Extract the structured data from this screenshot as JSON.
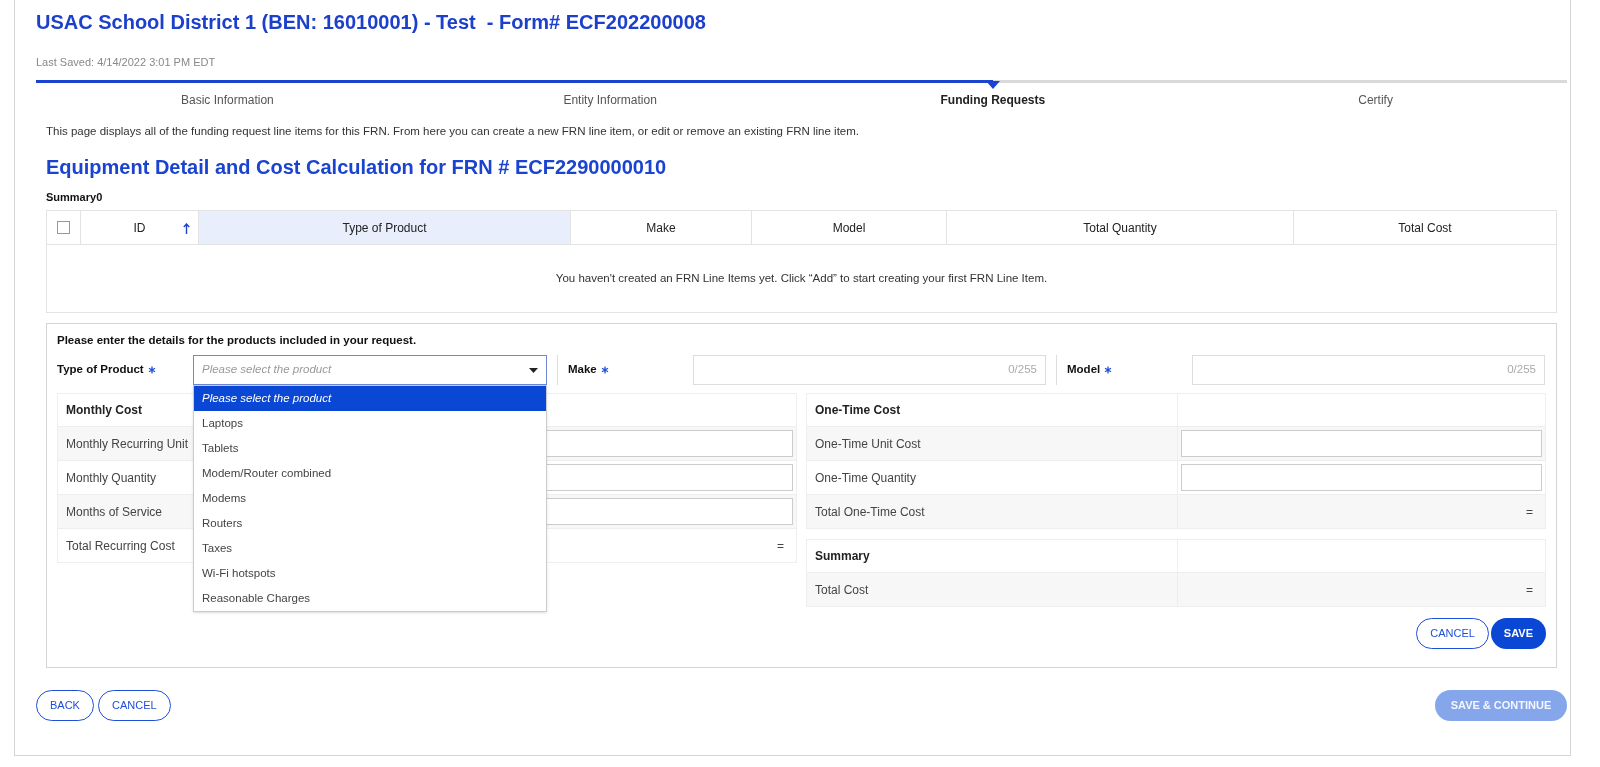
{
  "header": {
    "title": "USAC School District 1 (BEN: 16010001) - Test  - Form# ECF202200008",
    "last_saved": "Last Saved: 4/14/2022 3:01 PM EDT"
  },
  "steps": [
    {
      "label": "Basic Information",
      "completed": true,
      "selected": false
    },
    {
      "label": "Entity Information",
      "completed": true,
      "selected": false
    },
    {
      "label": "Funding Requests",
      "completed": false,
      "selected": true
    },
    {
      "label": "Certify",
      "completed": false,
      "selected": false
    }
  ],
  "intro": "This page displays all of the funding request line items for this FRN. From here you can create a new FRN line item, or edit or remove an existing FRN line item.",
  "heading": "Equipment Detail and Cost Calculation for FRN # ECF2290000010",
  "summary_label": "Summary0",
  "table": {
    "select_all_checked": false,
    "columns": [
      {
        "label": "ID",
        "sorted": true,
        "highlighted": false
      },
      {
        "label": "Type of Product",
        "sorted": false,
        "highlighted": true
      },
      {
        "label": "Make",
        "sorted": false,
        "highlighted": false
      },
      {
        "label": "Model",
        "sorted": false,
        "highlighted": false
      },
      {
        "label": "Total Quantity",
        "sorted": false,
        "highlighted": false
      },
      {
        "label": "Total Cost",
        "sorted": false,
        "highlighted": false
      }
    ],
    "empty_message": "You haven't created an FRN Line Items yet. Click “Add” to start creating your first FRN Line Item."
  },
  "form": {
    "instructions": "Please enter the details for the products included in your request.",
    "fields": [
      {
        "kind": "select",
        "label": "Type of Product",
        "required": true,
        "placeholder": "Please select the product"
      },
      {
        "kind": "text",
        "label": "Make",
        "required": true,
        "counter": "0/255"
      },
      {
        "kind": "text",
        "label": "Model",
        "required": true,
        "counter": "0/255"
      }
    ],
    "dropdown": {
      "open": true,
      "options": [
        {
          "label": "Please select the product",
          "selected": true
        },
        {
          "label": "Laptops",
          "selected": false
        },
        {
          "label": "Tablets",
          "selected": false
        },
        {
          "label": "Modem/Router combined",
          "selected": false
        },
        {
          "label": "Modems",
          "selected": false
        },
        {
          "label": "Routers",
          "selected": false
        },
        {
          "label": "Taxes",
          "selected": false
        },
        {
          "label": "Wi-Fi hotspots",
          "selected": false
        },
        {
          "label": "Reasonable Charges",
          "selected": false
        }
      ]
    },
    "monthly": {
      "title": "Monthly Cost",
      "rows": [
        {
          "kind": "input",
          "label": "Monthly Recurring Unit"
        },
        {
          "kind": "input",
          "label": "Monthly Quantity"
        },
        {
          "kind": "input",
          "label": "Months of Service"
        },
        {
          "kind": "total",
          "label": "Total Recurring Cost",
          "value": "="
        }
      ]
    },
    "one_time": {
      "title": "One-Time Cost",
      "rows": [
        {
          "kind": "input",
          "label": "One-Time Unit Cost"
        },
        {
          "kind": "input",
          "label": "One-Time Quantity"
        },
        {
          "kind": "total",
          "label": "Total One-Time Cost",
          "value": "="
        }
      ]
    },
    "summary": {
      "title": "Summary",
      "rows": [
        {
          "kind": "total",
          "label": "Total Cost",
          "value": "="
        }
      ]
    },
    "buttons": [
      {
        "label": "CANCEL",
        "kind": "outline",
        "disabled": false
      },
      {
        "label": "SAVE",
        "kind": "primary",
        "disabled": false
      }
    ]
  },
  "footer": {
    "left_buttons": [
      {
        "label": "BACK",
        "kind": "outline",
        "disabled": false
      },
      {
        "label": "CANCEL",
        "kind": "outline",
        "disabled": false
      }
    ],
    "right_buttons": [
      {
        "label": "SAVE & CONTINUE",
        "kind": "primary",
        "disabled": true
      }
    ]
  }
}
